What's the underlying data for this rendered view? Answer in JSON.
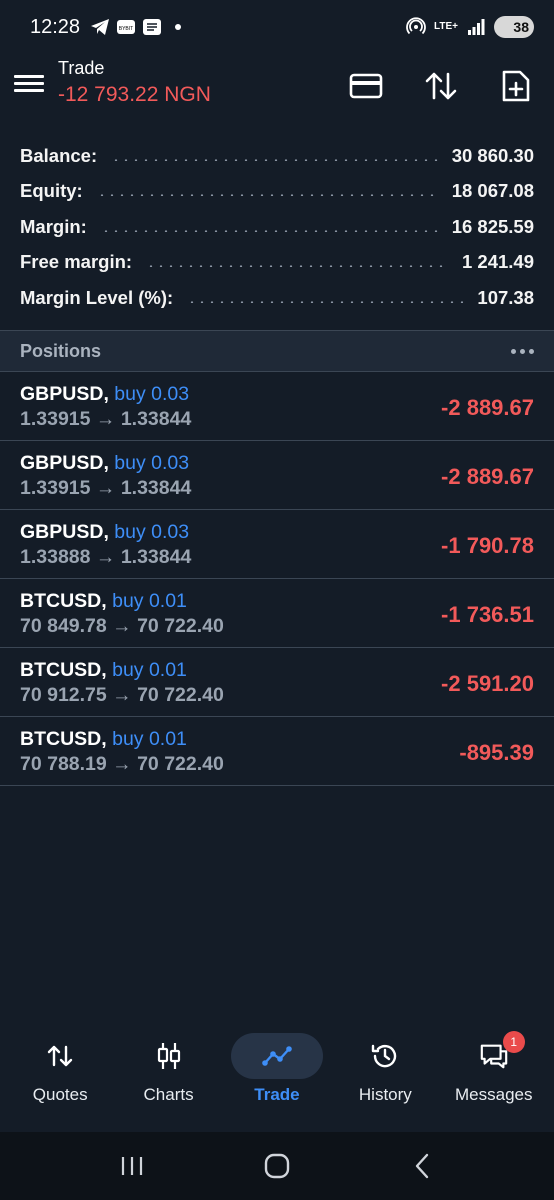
{
  "status_bar": {
    "time": "12:28",
    "network": "LTE+",
    "battery": "38",
    "icons": [
      "telegram-icon",
      "bybit-icon",
      "stacks-icon",
      "dot-icon",
      "hotspot-icon",
      "signal-icon"
    ]
  },
  "header": {
    "title": "Trade",
    "subtitle": "-12 793.22 NGN",
    "icons": [
      "menu-icon",
      "card-icon",
      "sort-icon",
      "new-order-icon"
    ]
  },
  "summary": [
    {
      "label": "Balance:",
      "value": "30 860.30"
    },
    {
      "label": "Equity:",
      "value": "18 067.08"
    },
    {
      "label": "Margin:",
      "value": "16 825.59"
    },
    {
      "label": "Free margin:",
      "value": "1 241.49"
    },
    {
      "label": "Margin Level (%):",
      "value": "107.38"
    }
  ],
  "positions_header": {
    "title": "Positions"
  },
  "positions": [
    {
      "symbol": "GBPUSD",
      "side": "buy 0.03",
      "prices": "1.33915 → 1.33844",
      "profit": "-2 889.67"
    },
    {
      "symbol": "GBPUSD",
      "side": "buy 0.03",
      "prices": "1.33915 → 1.33844",
      "profit": "-2 889.67"
    },
    {
      "symbol": "GBPUSD",
      "side": "buy 0.03",
      "prices": "1.33888 → 1.33844",
      "profit": "-1 790.78"
    },
    {
      "symbol": "BTCUSD",
      "side": "buy 0.01",
      "prices": "70 849.78 → 70 722.40",
      "profit": "-1 736.51"
    },
    {
      "symbol": "BTCUSD",
      "side": "buy 0.01",
      "prices": "70 912.75 → 70 722.40",
      "profit": "-2 591.20"
    },
    {
      "symbol": "BTCUSD",
      "side": "buy 0.01",
      "prices": "70 788.19 → 70 722.40",
      "profit": "-895.39"
    }
  ],
  "bottom_nav": [
    {
      "label": "Quotes",
      "icon": "quotes-icon"
    },
    {
      "label": "Charts",
      "icon": "charts-icon"
    },
    {
      "label": "Trade",
      "icon": "trade-icon",
      "active": true
    },
    {
      "label": "History",
      "icon": "history-icon"
    },
    {
      "label": "Messages",
      "icon": "messages-icon",
      "badge": "1"
    }
  ],
  "colors": {
    "background": "#141c27",
    "loss": "#f25a5a",
    "accent": "#3e8ef7",
    "section_header": "#1f2937"
  }
}
